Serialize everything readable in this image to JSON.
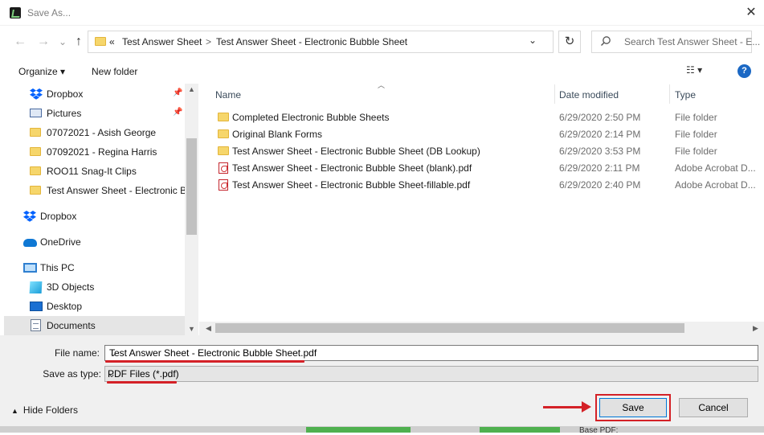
{
  "window": {
    "title": "Save As...",
    "close_glyph": "✕"
  },
  "nav": {
    "back_glyph": "←",
    "forward_glyph": "→",
    "up_glyph": "↑",
    "refresh_glyph": "↻"
  },
  "address": {
    "overflow": "«",
    "segments": [
      "Test Answer Sheet",
      "Test Answer Sheet - Electronic Bubble Sheet"
    ],
    "separator": ">",
    "dropdown_glyph": "⌄"
  },
  "search": {
    "placeholder": "Search Test Answer Sheet - E..."
  },
  "toolbar": {
    "organize": "Organize ▾",
    "new_folder": "New folder",
    "view_glyph": "☷ ▾",
    "help": "?"
  },
  "sidebar": {
    "items": [
      {
        "label": "Dropbox",
        "icon": "dropbox-icon",
        "pinned": true
      },
      {
        "label": "Pictures",
        "icon": "pictures-icon",
        "pinned": true
      },
      {
        "label": "07072021 - Asish George",
        "icon": "folder-icon"
      },
      {
        "label": "07092021 - Regina Harris",
        "icon": "folder-icon"
      },
      {
        "label": "ROO11 Snag-It Clips",
        "icon": "folder-icon"
      },
      {
        "label": "Test Answer Sheet - Electronic Bu",
        "icon": "folder-icon"
      },
      {
        "label": "Dropbox",
        "icon": "dropbox-icon"
      },
      {
        "label": "OneDrive",
        "icon": "onedrive-icon"
      },
      {
        "label": "This PC",
        "icon": "pc-icon"
      },
      {
        "label": "3D Objects",
        "icon": "cube-icon"
      },
      {
        "label": "Desktop",
        "icon": "desktop-icon"
      },
      {
        "label": "Documents",
        "icon": "documents-icon",
        "selected": true
      }
    ],
    "pin_glyph": "📌"
  },
  "list": {
    "columns": {
      "name": "Name",
      "date": "Date modified",
      "type": "Type"
    },
    "rows": [
      {
        "name": "Completed Electronic Bubble Sheets",
        "date": "6/29/2020 2:50 PM",
        "type": "File folder",
        "icon": "folder-icon"
      },
      {
        "name": "Original Blank Forms",
        "date": "6/29/2020 2:14 PM",
        "type": "File folder",
        "icon": "folder-icon"
      },
      {
        "name": "Test Answer Sheet - Electronic Bubble Sheet (DB Lookup)",
        "date": "6/29/2020 3:53 PM",
        "type": "File folder",
        "icon": "folder-icon"
      },
      {
        "name": "Test Answer Sheet - Electronic Bubble Sheet (blank).pdf",
        "date": "6/29/2020 2:11 PM",
        "type": "Adobe Acrobat D...",
        "icon": "pdf-icon"
      },
      {
        "name": "Test Answer Sheet - Electronic Bubble Sheet-fillable.pdf",
        "date": "6/29/2020 2:40 PM",
        "type": "Adobe Acrobat D...",
        "icon": "pdf-icon"
      }
    ]
  },
  "form": {
    "file_name_label": "File name:",
    "file_name_value": "Test Answer Sheet - Electronic Bubble Sheet.pdf",
    "save_type_label": "Save as type:",
    "save_type_value": "PDF Files (*.pdf)"
  },
  "footer": {
    "hide_folders": "Hide Folders",
    "save": "Save",
    "cancel": "Cancel"
  },
  "background": {
    "base_pdf": "Base PDF:"
  },
  "colors": {
    "annotation_red": "#d42127",
    "accent_blue": "#0078d7"
  }
}
